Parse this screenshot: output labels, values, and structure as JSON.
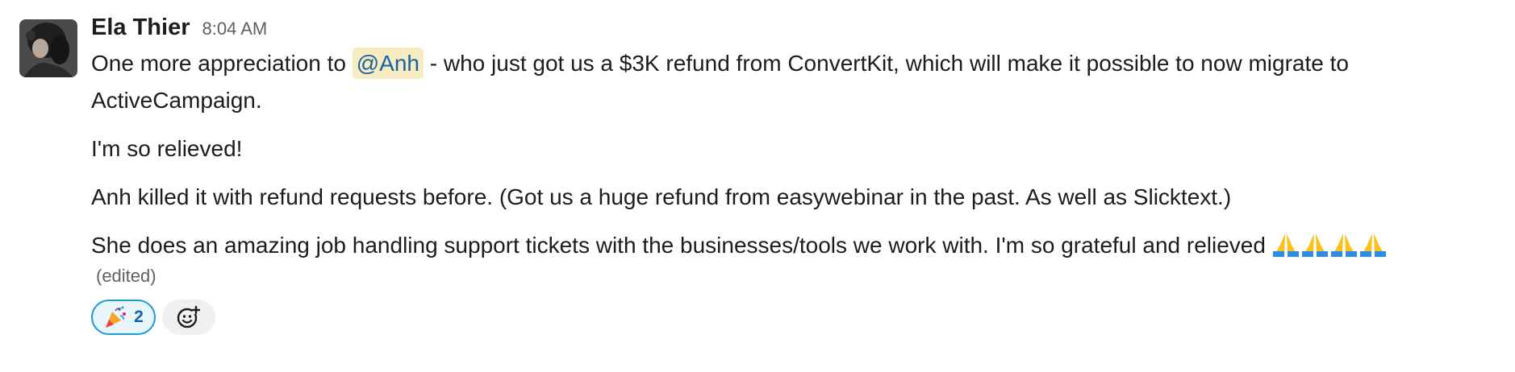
{
  "message": {
    "sender": "Ela Thier",
    "timestamp": "8:04 AM",
    "paragraphs": {
      "p1_before": "One more appreciation to ",
      "p1_mention": "@Anh",
      "p1_after": " - who just got us a $3K refund from ConvertKit, which will make it possible to now migrate to ActiveCampaign.",
      "p2": "I'm so relieved!",
      "p3": "Anh killed it with refund requests before. (Got us a huge refund from easywebinar in the past. As well as Slicktext.)",
      "p4": "She does an amazing job handling support tickets with the businesses/tools we work with. I'm so grateful and relieved "
    },
    "trailing_emoji": [
      "folded-hands",
      "folded-hands",
      "folded-hands",
      "folded-hands"
    ],
    "edited_label": "(edited)"
  },
  "reactions": [
    {
      "emoji": "party-popper",
      "count": "2",
      "selected": true
    }
  ],
  "add_reaction": {
    "icon": "add-reaction-icon"
  },
  "colors": {
    "mention_bg": "#f9ebc1",
    "mention_text": "#1264a3",
    "reaction_border": "#1d9bd1",
    "reaction_bg": "#e8f5fa",
    "muted_text": "#616061"
  }
}
